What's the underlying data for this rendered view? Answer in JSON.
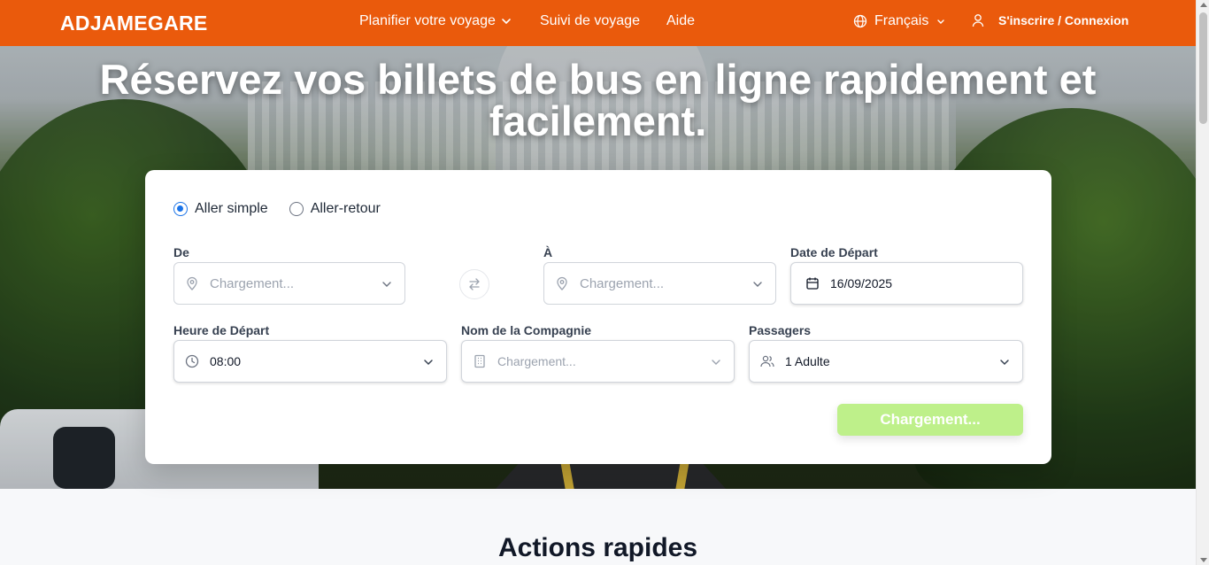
{
  "header": {
    "logo": "ADJAMEGARE",
    "nav": {
      "plan_trip": "Planifier votre voyage",
      "trip_tracking": "Suivi de voyage",
      "help": "Aide"
    },
    "language": "Français",
    "auth": "S'inscrire / Connexion",
    "brand_color": "#ea5a0c"
  },
  "hero": {
    "title": "Réservez vos billets de bus en ligne rapidement et facilement."
  },
  "search": {
    "trip_types": [
      "Aller simple",
      "Aller-retour"
    ],
    "selected_trip_type": "Aller simple",
    "from": {
      "label": "De",
      "placeholder": "Chargement..."
    },
    "to": {
      "label": "À",
      "placeholder": "Chargement..."
    },
    "departure_date": {
      "label": "Date de Départ",
      "value": "16/09/2025"
    },
    "departure_time": {
      "label": "Heure de Départ",
      "value": "08:00"
    },
    "company": {
      "label": "Nom de la Compagnie",
      "placeholder": "Chargement..."
    },
    "passengers": {
      "label": "Passagers",
      "value": "1 Adulte"
    },
    "submit_label": "Chargement...",
    "submit_color": "#bef08a"
  },
  "quick_actions": {
    "title": "Actions rapides"
  },
  "icons": [
    "globe-icon",
    "user-icon",
    "chevron-down-icon",
    "map-pin-icon",
    "swap-icon",
    "calendar-icon",
    "clock-icon",
    "building-icon",
    "users-icon"
  ]
}
